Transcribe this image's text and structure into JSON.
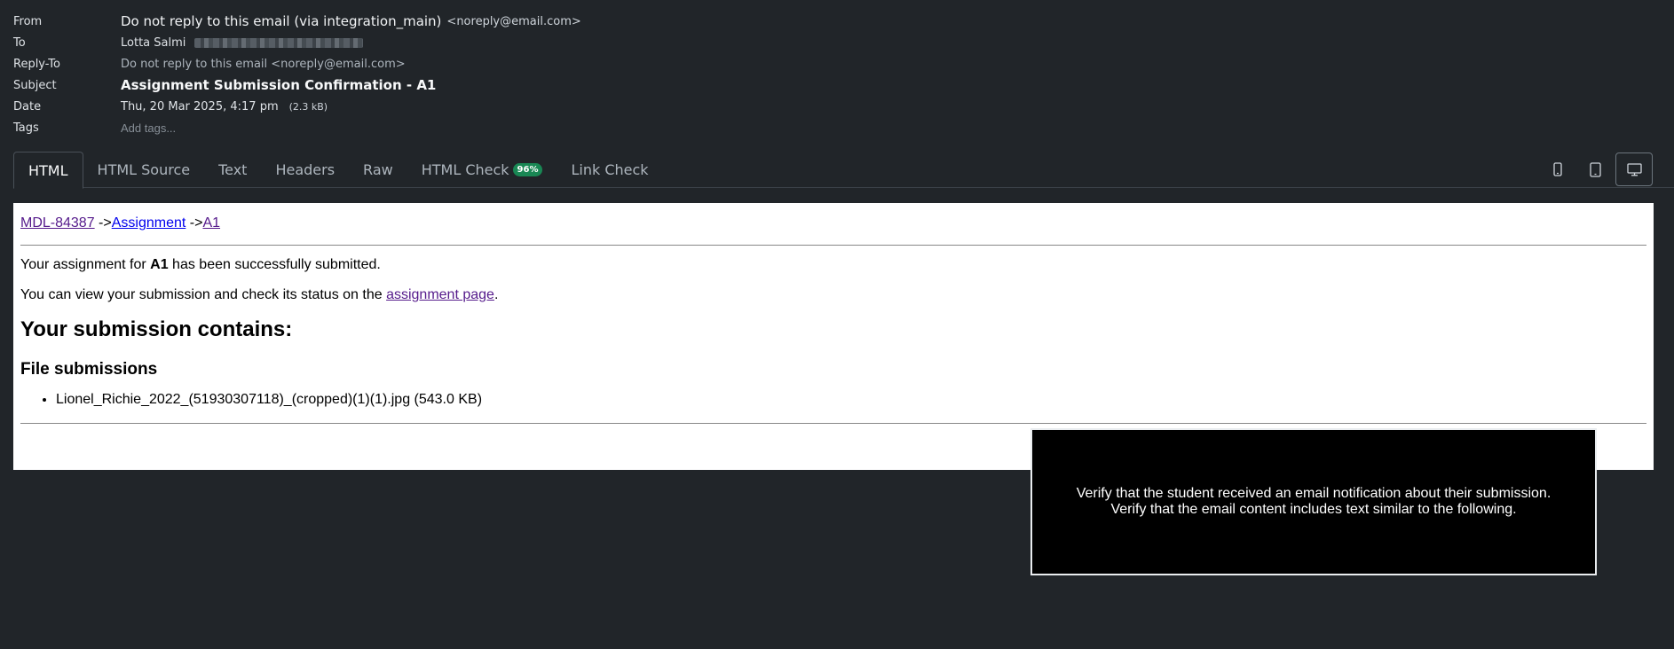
{
  "headers": {
    "from_label": "From",
    "from_name": "Do not reply to this email  (via integration_main)",
    "from_addr": "<noreply@email.com>",
    "to_label": "To",
    "to_name": "Lotta Salmi",
    "replyto_label": "Reply-To",
    "replyto_value": "Do not reply to this email <noreply@email.com>",
    "subject_label": "Subject",
    "subject_value": "Assignment Submission Confirmation - A1",
    "date_label": "Date",
    "date_value": "Thu, 20 Mar 2025, 4:17 pm",
    "size_value": "(2.3 kB)",
    "tags_label": "Tags",
    "tags_placeholder": "Add tags..."
  },
  "tabs": {
    "html": "HTML",
    "html_source": "HTML Source",
    "text": "Text",
    "headers": "Headers",
    "raw": "Raw",
    "html_check": "HTML Check",
    "html_check_badge": "96%",
    "link_check": "Link Check"
  },
  "device_icons": [
    "phone-icon",
    "tablet-icon",
    "desktop-icon"
  ],
  "email": {
    "crumb_course": "MDL-84387",
    "crumb_sep": " ->",
    "crumb_module": "Assignment",
    "crumb_item": "A1",
    "line1_pre": "Your assignment for ",
    "line1_bold": "A1",
    "line1_post": " has been successfully submitted.",
    "line2_pre": "You can view your submission and check its status on the ",
    "line2_link": "assignment page",
    "line2_post": ".",
    "heading": "Your submission contains:",
    "subheading": "File submissions",
    "files": [
      "Lionel_Richie_2022_(51930307118)_(cropped)(1)(1).jpg (543.0 KB)"
    ]
  },
  "overlay": {
    "line1": "Verify that the student received an email notification about their submission.",
    "line2": "Verify that the email content includes text similar to the following."
  },
  "colors": {
    "background": "#212529",
    "badge": "#198754",
    "link_visited": "#551a8b",
    "link": "#0000ee"
  }
}
